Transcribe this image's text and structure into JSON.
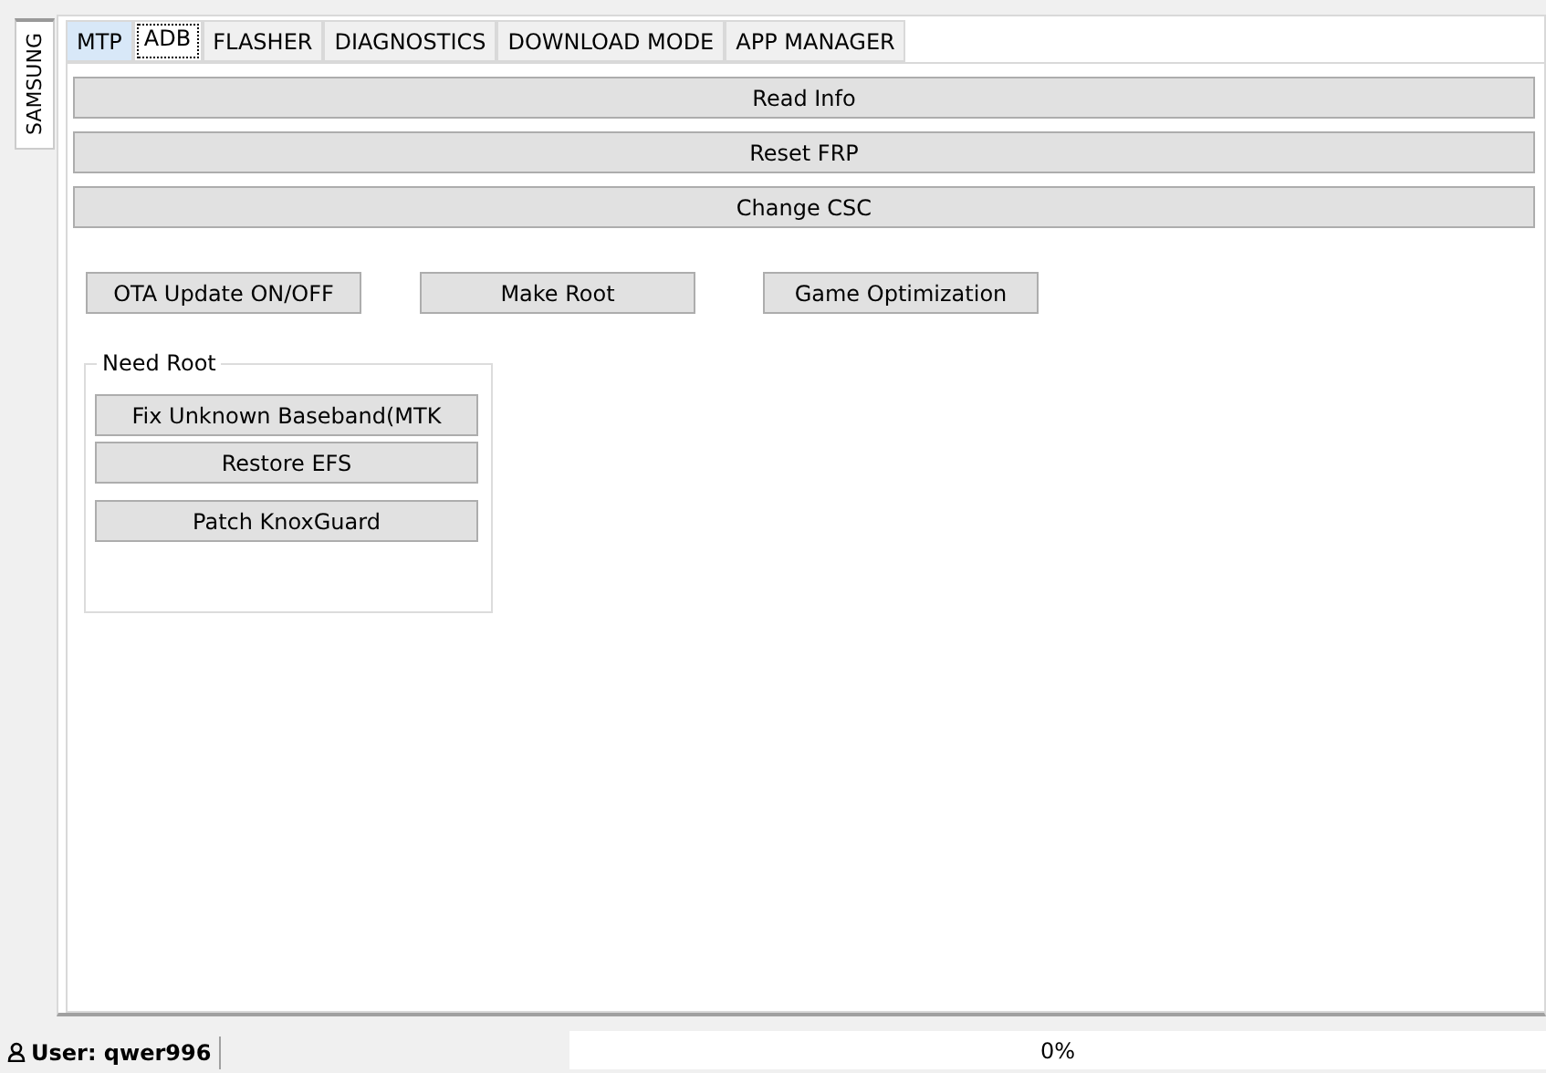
{
  "side_tabs": [
    {
      "label": "SAMSUNG",
      "selected": true
    }
  ],
  "tabs": [
    {
      "label": "MTP",
      "selected": false,
      "highlighted": true
    },
    {
      "label": "ADB",
      "selected": true,
      "highlighted": false
    },
    {
      "label": "FLASHER",
      "selected": false,
      "highlighted": false
    },
    {
      "label": "DIAGNOSTICS",
      "selected": false,
      "highlighted": false
    },
    {
      "label": "DOWNLOAD MODE",
      "selected": false,
      "highlighted": false
    },
    {
      "label": "APP MANAGER",
      "selected": false,
      "highlighted": false
    }
  ],
  "wide_buttons": [
    "Read Info",
    "Reset FRP",
    "Change CSC"
  ],
  "row_buttons": [
    "OTA Update ON/OFF",
    "Make Root",
    "Game Optimization"
  ],
  "group": {
    "title": "Need Root",
    "buttons": [
      "Fix Unknown Baseband(MTK",
      "Restore EFS",
      "Patch KnoxGuard"
    ]
  },
  "status_bar": {
    "user": "User: qwer996",
    "progress": {
      "level": 0,
      "reading": "0%"
    }
  }
}
